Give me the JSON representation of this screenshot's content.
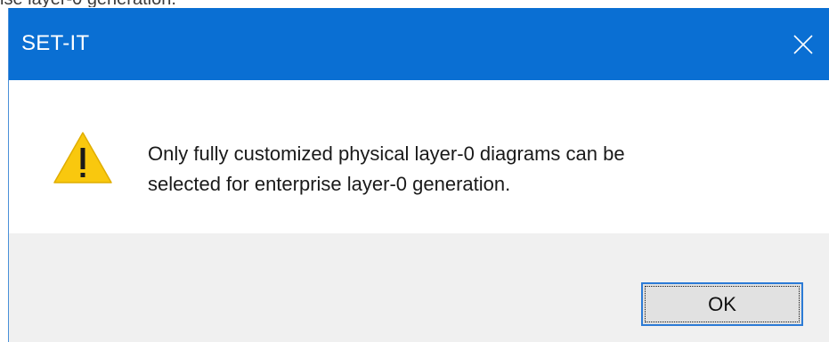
{
  "background_text": "ise layer-0 generation.",
  "dialog": {
    "title": "SET-IT",
    "close_icon": "close-icon",
    "icon": "warning-icon",
    "message_line1": "Only fully customized physical layer-0 diagrams can be",
    "message_line2": "selected for enterprise layer-0 generation.",
    "ok_label": "OK"
  },
  "colors": {
    "titlebar": "#0a6fd3",
    "footer": "#f0f0f0",
    "warning_yellow": "#f9c80e",
    "button_focus_border": "#2c7bd6"
  }
}
